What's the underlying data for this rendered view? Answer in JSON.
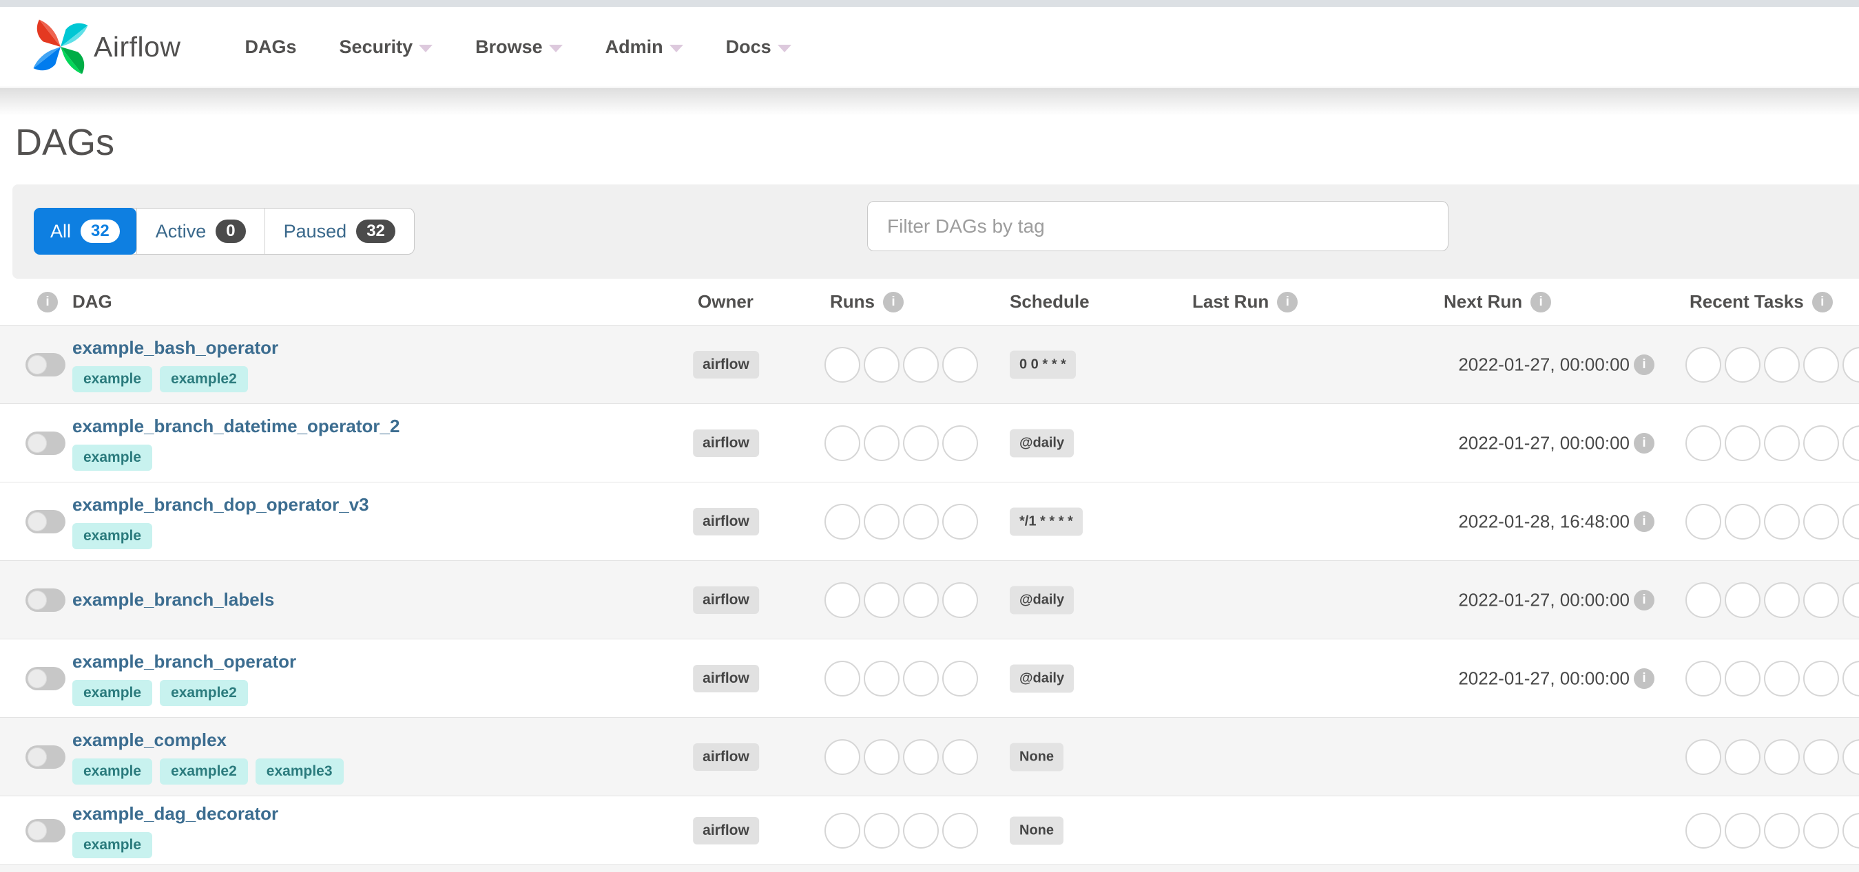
{
  "nav": {
    "brand": "Airflow",
    "items": [
      {
        "label": "DAGs",
        "has_menu": false
      },
      {
        "label": "Security",
        "has_menu": true
      },
      {
        "label": "Browse",
        "has_menu": true
      },
      {
        "label": "Admin",
        "has_menu": true
      },
      {
        "label": "Docs",
        "has_menu": true
      }
    ]
  },
  "page": {
    "title": "DAGs"
  },
  "filters": {
    "tabs": [
      {
        "label": "All",
        "count": "32",
        "active": true
      },
      {
        "label": "Active",
        "count": "0",
        "active": false
      },
      {
        "label": "Paused",
        "count": "32",
        "active": false
      }
    ],
    "search_placeholder": "Filter DAGs by tag"
  },
  "table": {
    "headers": [
      {
        "label": "DAG",
        "info": false
      },
      {
        "label": "Owner",
        "info": false
      },
      {
        "label": "Runs",
        "info": true
      },
      {
        "label": "Schedule",
        "info": false
      },
      {
        "label": "Last Run",
        "info": true
      },
      {
        "label": "Next Run",
        "info": true
      },
      {
        "label": "Recent Tasks",
        "info": true
      }
    ],
    "info_icon_glyph": "i"
  },
  "rows": [
    {
      "name": "example_bash_operator",
      "tags": [
        "example",
        "example2"
      ],
      "owner": "airflow",
      "schedule": "0 0 * * *",
      "last_run": "",
      "next_run": "2022-01-27, 00:00:00",
      "runs_count": 4,
      "recent_tasks_count": 5,
      "shaded": true
    },
    {
      "name": "example_branch_datetime_operator_2",
      "tags": [
        "example"
      ],
      "owner": "airflow",
      "schedule": "@daily",
      "last_run": "",
      "next_run": "2022-01-27, 00:00:00",
      "runs_count": 4,
      "recent_tasks_count": 5,
      "shaded": false
    },
    {
      "name": "example_branch_dop_operator_v3",
      "tags": [
        "example"
      ],
      "owner": "airflow",
      "schedule": "*/1 * * * *",
      "last_run": "",
      "next_run": "2022-01-28, 16:48:00",
      "runs_count": 4,
      "recent_tasks_count": 5,
      "shaded": false
    },
    {
      "name": "example_branch_labels",
      "tags": [],
      "owner": "airflow",
      "schedule": "@daily",
      "last_run": "",
      "next_run": "2022-01-27, 00:00:00",
      "runs_count": 4,
      "recent_tasks_count": 5,
      "shaded": true
    },
    {
      "name": "example_branch_operator",
      "tags": [
        "example",
        "example2"
      ],
      "owner": "airflow",
      "schedule": "@daily",
      "last_run": "",
      "next_run": "2022-01-27, 00:00:00",
      "runs_count": 4,
      "recent_tasks_count": 5,
      "shaded": false
    },
    {
      "name": "example_complex",
      "tags": [
        "example",
        "example2",
        "example3"
      ],
      "owner": "airflow",
      "schedule": "None",
      "last_run": "",
      "next_run": "",
      "runs_count": 4,
      "recent_tasks_count": 5,
      "shaded": true
    },
    {
      "name": "example_dag_decorator",
      "tags": [
        "example"
      ],
      "owner": "airflow",
      "schedule": "None",
      "last_run": "",
      "next_run": "",
      "runs_count": 4,
      "recent_tasks_count": 5,
      "shaded": false
    }
  ],
  "colors": {
    "accent_blue": "#0e7fe1",
    "link_blue": "#3c6d90",
    "tag_bg": "#c8f2ef",
    "tag_text": "#2b7b7d",
    "badge_gray": "#e3e3e3",
    "row_stripe": "#f5f5f5",
    "nav_text": "#51504f",
    "logo_red": "#e43921",
    "logo_teal": "#00c7d4",
    "logo_green": "#00ad46",
    "logo_blue": "#017cee"
  }
}
